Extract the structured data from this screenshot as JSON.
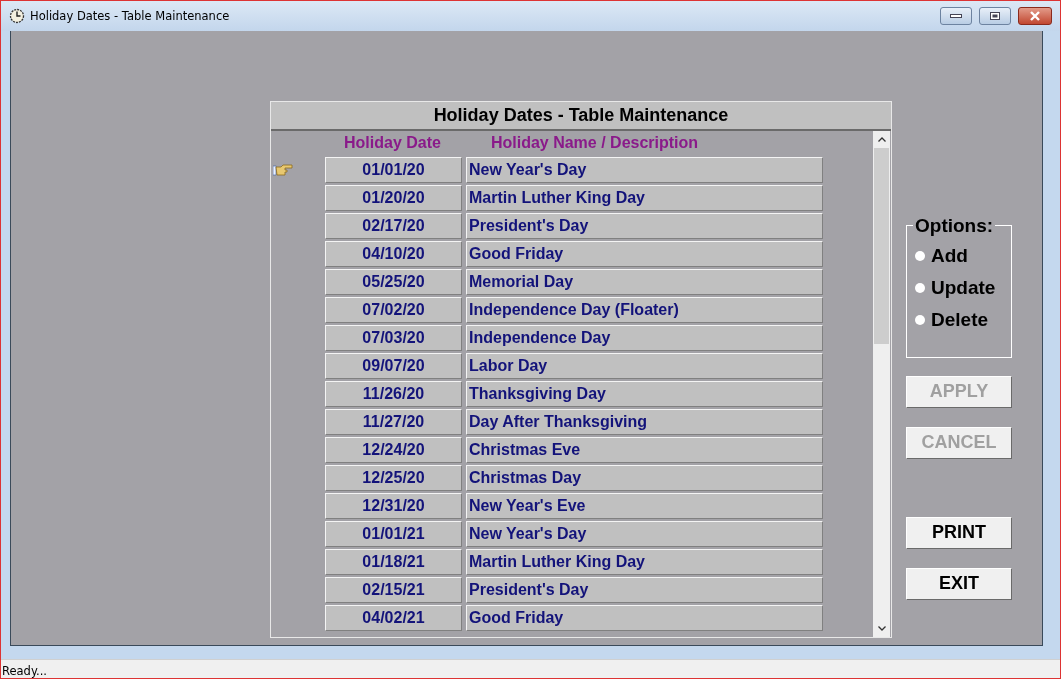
{
  "window": {
    "title": "Holiday Dates - Table Maintenance"
  },
  "panel": {
    "title": "Holiday Dates - Table Maintenance",
    "columns": [
      "Holiday Date",
      "Holiday Name / Description"
    ],
    "rows": [
      {
        "date": "01/01/20",
        "name": "New Year's Day",
        "selected": true
      },
      {
        "date": "01/20/20",
        "name": "Martin Luther King Day",
        "selected": false
      },
      {
        "date": "02/17/20",
        "name": "President's Day",
        "selected": false
      },
      {
        "date": "04/10/20",
        "name": "Good Friday",
        "selected": false
      },
      {
        "date": "05/25/20",
        "name": "Memorial Day",
        "selected": false
      },
      {
        "date": "07/02/20",
        "name": "Independence Day (Floater)",
        "selected": false
      },
      {
        "date": "07/03/20",
        "name": "Independence Day",
        "selected": false
      },
      {
        "date": "09/07/20",
        "name": "Labor Day",
        "selected": false
      },
      {
        "date": "11/26/20",
        "name": "Thanksgiving Day",
        "selected": false
      },
      {
        "date": "11/27/20",
        "name": "Day After Thanksgiving",
        "selected": false
      },
      {
        "date": "12/24/20",
        "name": "Christmas Eve",
        "selected": false
      },
      {
        "date": "12/25/20",
        "name": "Christmas Day",
        "selected": false
      },
      {
        "date": "12/31/20",
        "name": "New Year's Eve",
        "selected": false
      },
      {
        "date": "01/01/21",
        "name": "New Year's Day",
        "selected": false
      },
      {
        "date": "01/18/21",
        "name": "Martin Luther King Day",
        "selected": false
      },
      {
        "date": "02/15/21",
        "name": "President's Day",
        "selected": false
      },
      {
        "date": "04/02/21",
        "name": "Good Friday",
        "selected": false
      }
    ]
  },
  "options": {
    "title": "Options:",
    "items": [
      {
        "label": "Add",
        "selected": false
      },
      {
        "label": "Update",
        "selected": false
      },
      {
        "label": "Delete",
        "selected": false
      }
    ]
  },
  "buttons": [
    {
      "label": "APPLY",
      "disabled": true
    },
    {
      "label": "CANCEL",
      "disabled": true
    },
    {
      "label": "PRINT",
      "disabled": false
    },
    {
      "label": "EXIT",
      "disabled": false
    }
  ],
  "status_bar": "Ready..."
}
